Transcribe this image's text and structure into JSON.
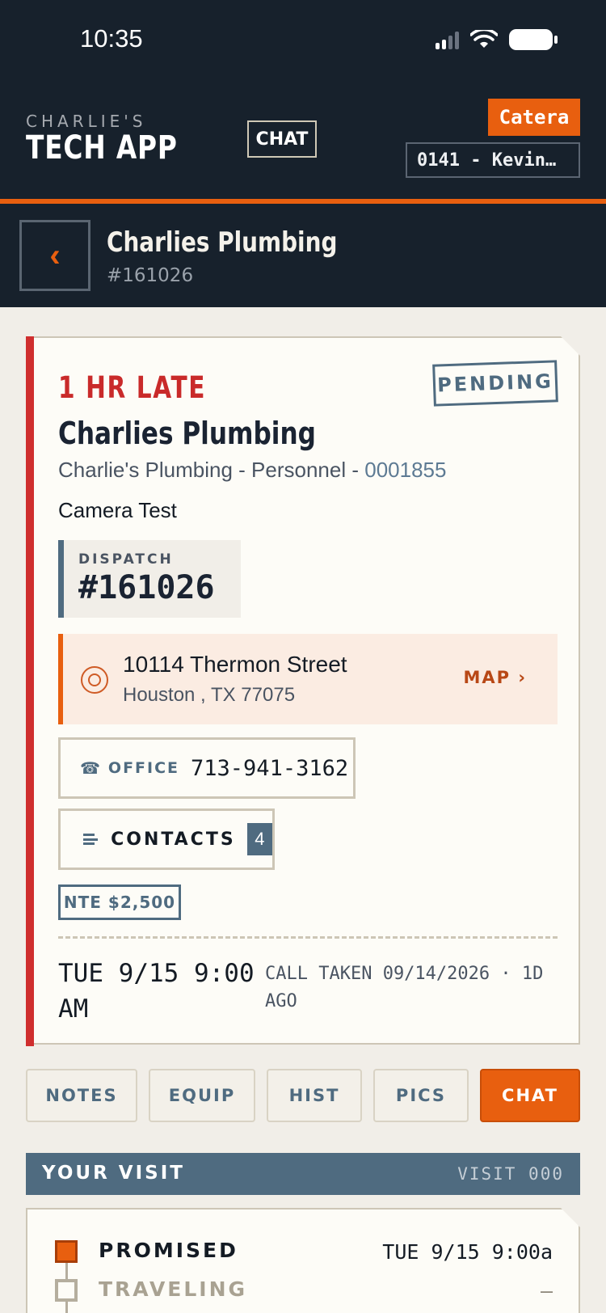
{
  "status_bar": {
    "time": "10:35"
  },
  "header": {
    "brand_small": "CHARLIE'S",
    "brand_big": "TECH APP",
    "chat_label": "CHAT",
    "company_badge": "Catera",
    "tech_selector": "0141 - Kevin…"
  },
  "subheader": {
    "title": "Charlies Plumbing",
    "ticket": "#161026"
  },
  "job_card": {
    "late_status": "1 HR LATE",
    "pending_stamp": "PENDING",
    "customer_name": "Charlies Plumbing",
    "account_name": "Charlie's Plumbing - Personnel",
    "account_sep": " - ",
    "account_code": "0001855",
    "job_description": "Camera Test",
    "dispatch_label": "DISPATCH",
    "dispatch_number": "#161026",
    "address_line1": "10114 Thermon Street",
    "address_line2": "Houston , TX 77075",
    "map_label": "MAP ›",
    "phone_label": "OFFICE",
    "phone_number": "713-941-3162",
    "contacts_label": "CONTACTS",
    "contacts_count": "4",
    "nte": "NTE $2,500",
    "scheduled": "TUE 9/15 9:00 AM",
    "call_taken": "CALL TAKEN 09/14/2026 · 1D AGO"
  },
  "tabs": [
    {
      "label": "NOTES"
    },
    {
      "label": "EQUIP"
    },
    {
      "label": "HIST"
    },
    {
      "label": "PICS"
    },
    {
      "label": "CHAT",
      "active": true
    }
  ],
  "visit": {
    "title": "YOUR VISIT",
    "visit_number": "VISIT 000",
    "steps": [
      {
        "label": "PROMISED",
        "time": "TUE 9/15 9:00a",
        "state": "current"
      },
      {
        "label": "TRAVELING",
        "time": "—",
        "state": "pending"
      }
    ]
  },
  "colors": {
    "accent": "#e85f0f",
    "dark": "#17212c",
    "late_red": "#c92a2a",
    "slate_blue": "#4f6b80",
    "background": "#f1eee8"
  }
}
